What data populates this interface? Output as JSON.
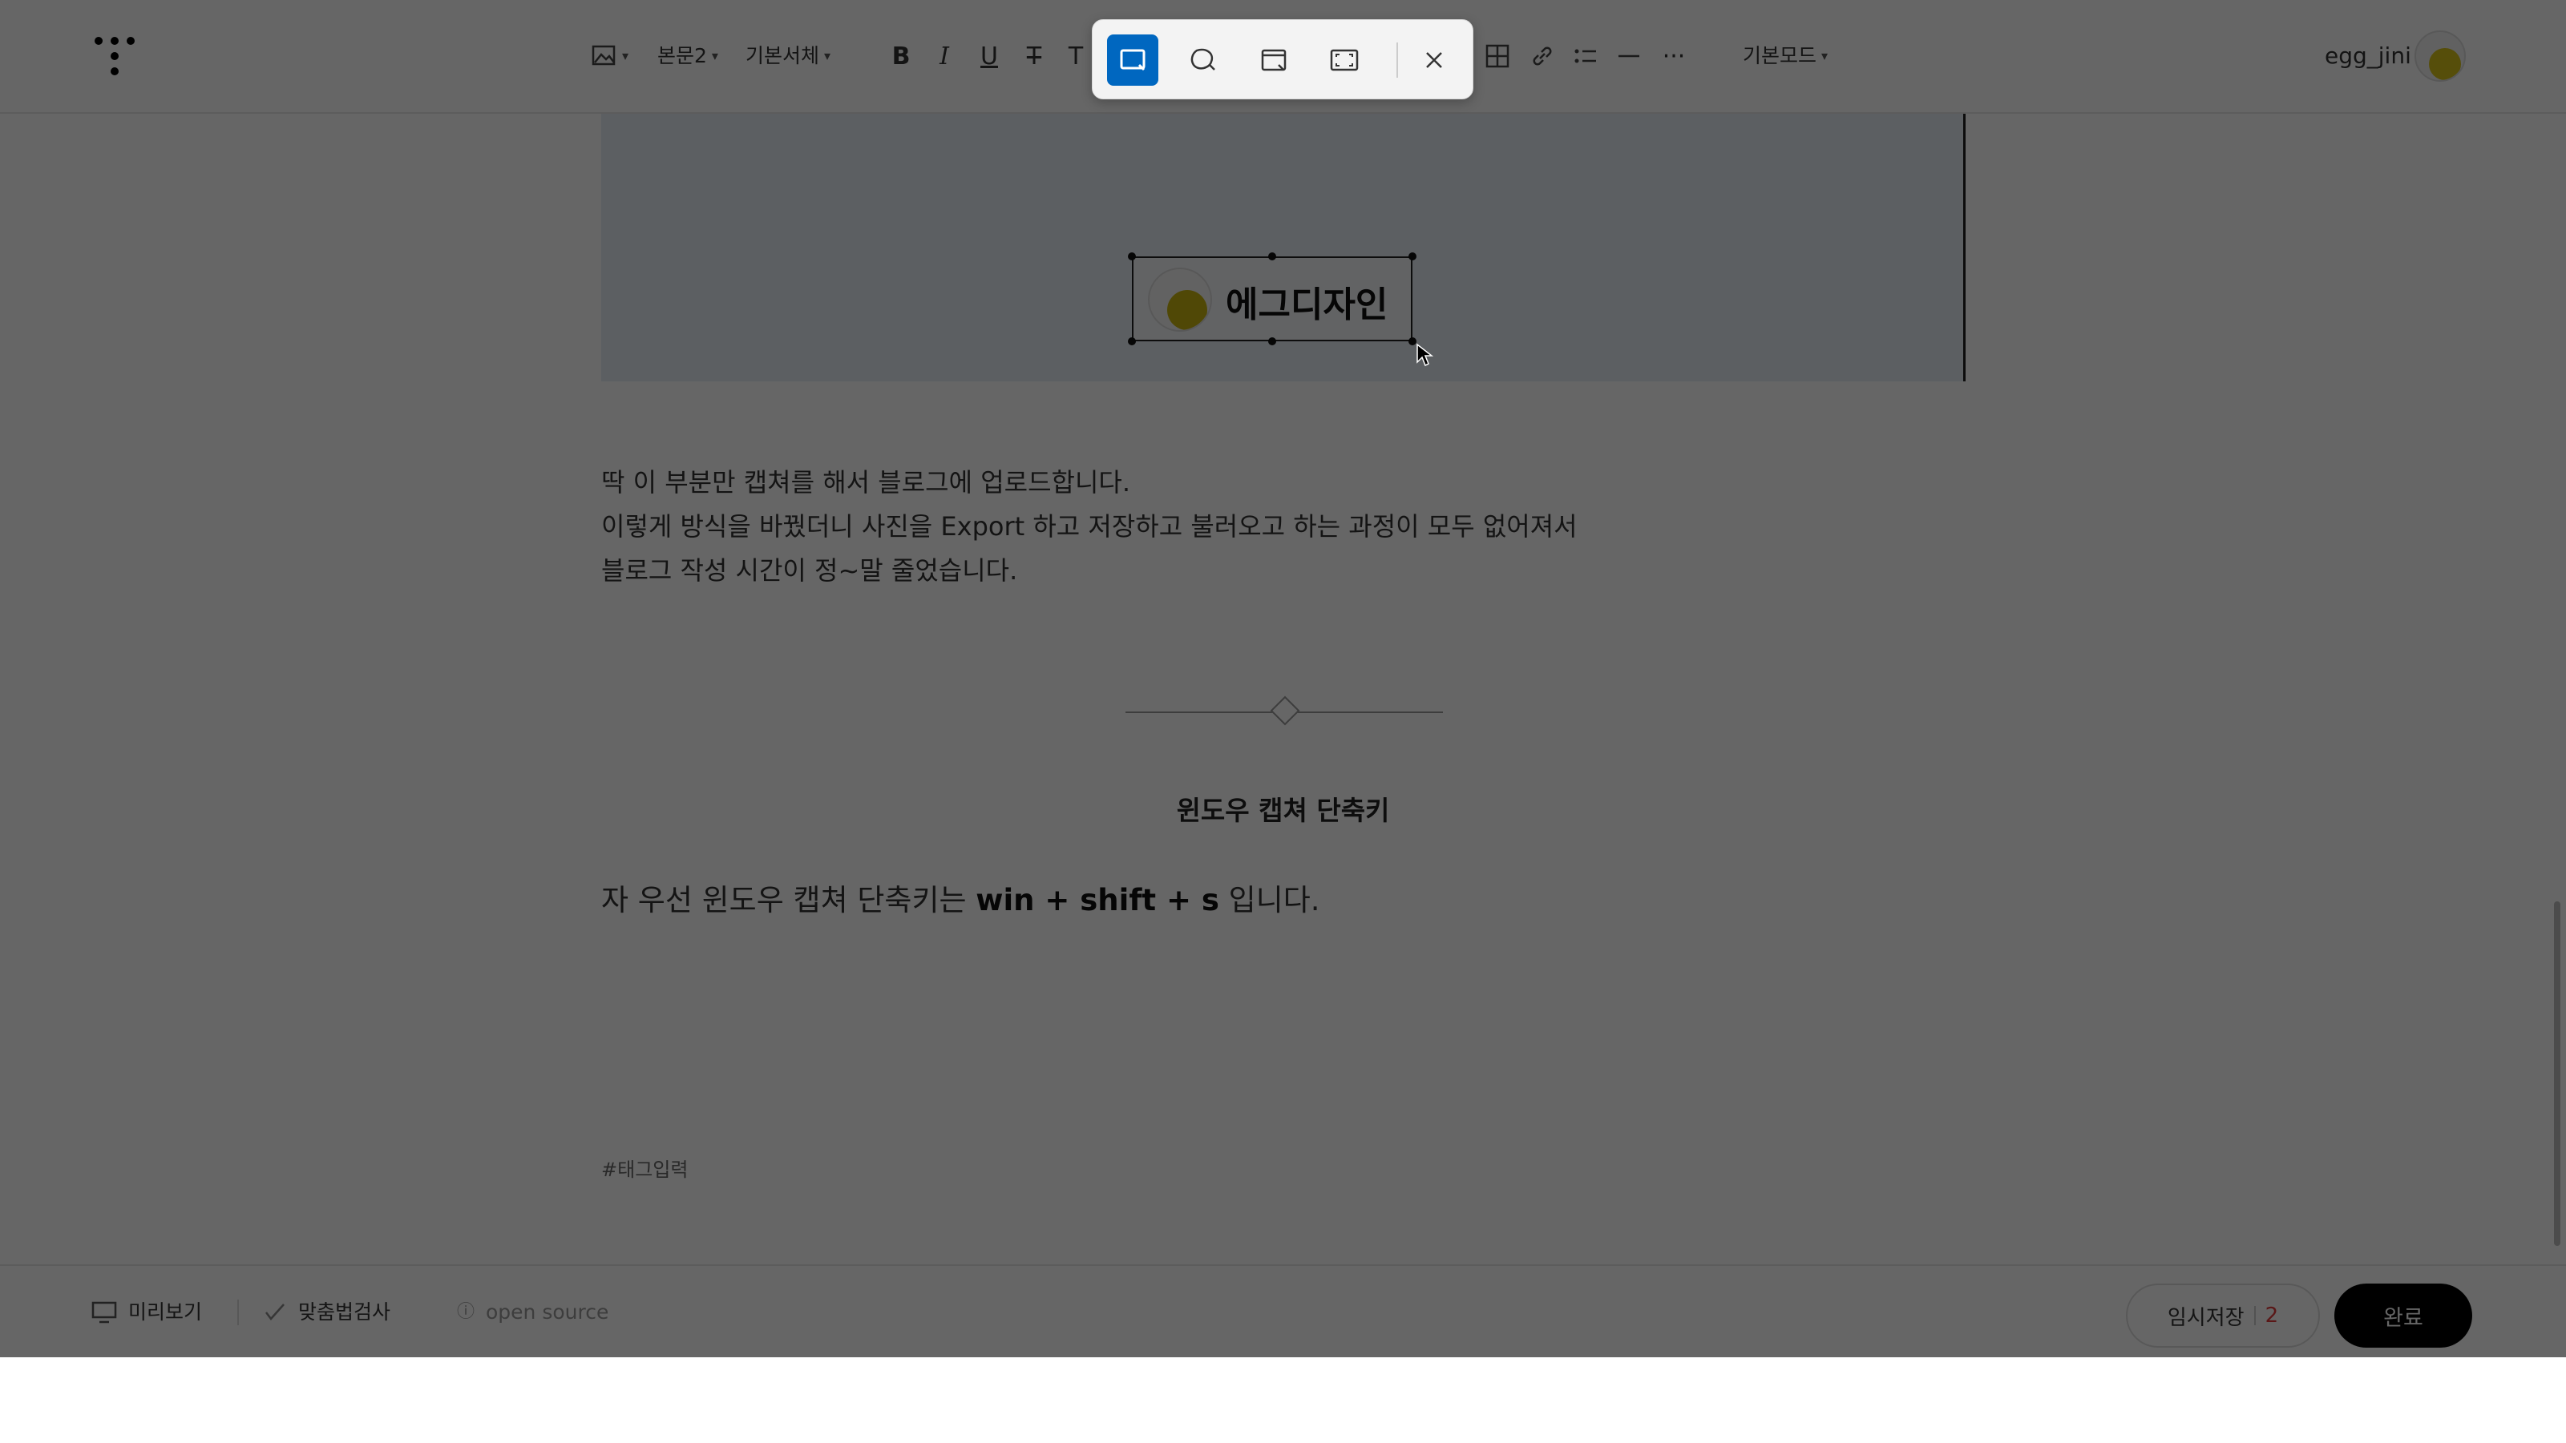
{
  "topbar": {
    "style_label": "본문2",
    "font_label": "기본서체",
    "mode_label": "기본모드",
    "username": "egg_jini",
    "icons": [
      "image-icon",
      "bold-icon",
      "italic-icon",
      "underline-icon",
      "strikethrough-icon",
      "text-color-icon",
      "table-icon",
      "link-icon",
      "list-icon",
      "hr-icon",
      "more-icon"
    ]
  },
  "snip_toolbar": {
    "modes": [
      "rectangle-snip-icon",
      "freeform-snip-icon",
      "window-snip-icon",
      "fullscreen-snip-icon"
    ],
    "active_mode": "rectangle-snip-icon",
    "close": "close-icon",
    "accent": "#0067c0"
  },
  "editor": {
    "snippet_brand": "에그디자인",
    "lines": [
      "딱 이 부분만 캡쳐를 해서 블로그에 업로드합니다.",
      "이렇게 방식을 바꿨더니 사진을 Export 하고 저장하고 불러오고 하는 과정이 모두 없어져서",
      "블로그 작성 시간이 정~말 줄었습니다."
    ],
    "heading": "윈도우 캡쳐 단축키",
    "para_prefix": "자 우선 윈도우 캡쳐 단축키는 ",
    "para_bold": "win + shift + s",
    "para_suffix": " 입니다.",
    "tag_placeholder": "#태그입력"
  },
  "bottombar": {
    "preview": "미리보기",
    "spellcheck": "맞춤법검사",
    "opensource": "open source",
    "temp_save": "임시저장",
    "temp_count": "2",
    "done": "완료"
  }
}
